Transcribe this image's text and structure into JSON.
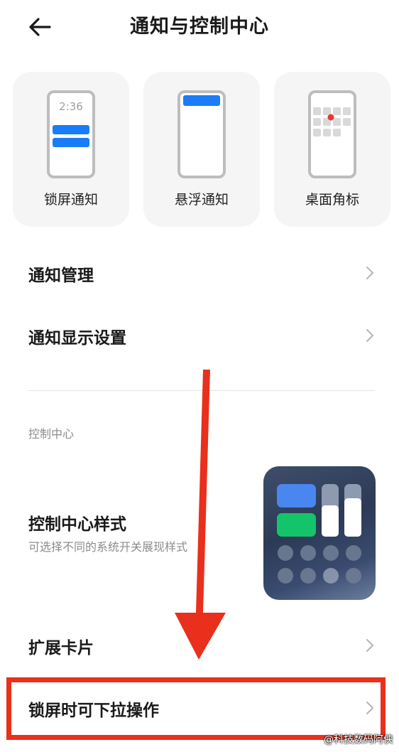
{
  "header": {
    "title": "通知与控制中心",
    "back_icon": "arrow-left-icon"
  },
  "cards": [
    {
      "label": "锁屏通知",
      "clock": "2:36",
      "icon": "lockscreen-notification-icon"
    },
    {
      "label": "悬浮通知",
      "icon": "floating-notification-icon"
    },
    {
      "label": "桌面角标",
      "icon": "badge-icon"
    }
  ],
  "menu": {
    "notification_management": "通知管理",
    "notification_display": "通知显示设置"
  },
  "control_center": {
    "section_label": "控制中心",
    "style_title": "控制中心样式",
    "style_subtitle": "可选择不同的系统开关展现样式",
    "expand_cards": "扩展卡片",
    "lockscreen_pulldown": "锁屏时可下拉操作"
  },
  "watermark": "@科技数码阿侠",
  "colors": {
    "accent_blue": "#1a7cf7",
    "highlight_red": "#e8301c",
    "badge_red": "#e53935",
    "toggle_green": "#1fc46a"
  }
}
